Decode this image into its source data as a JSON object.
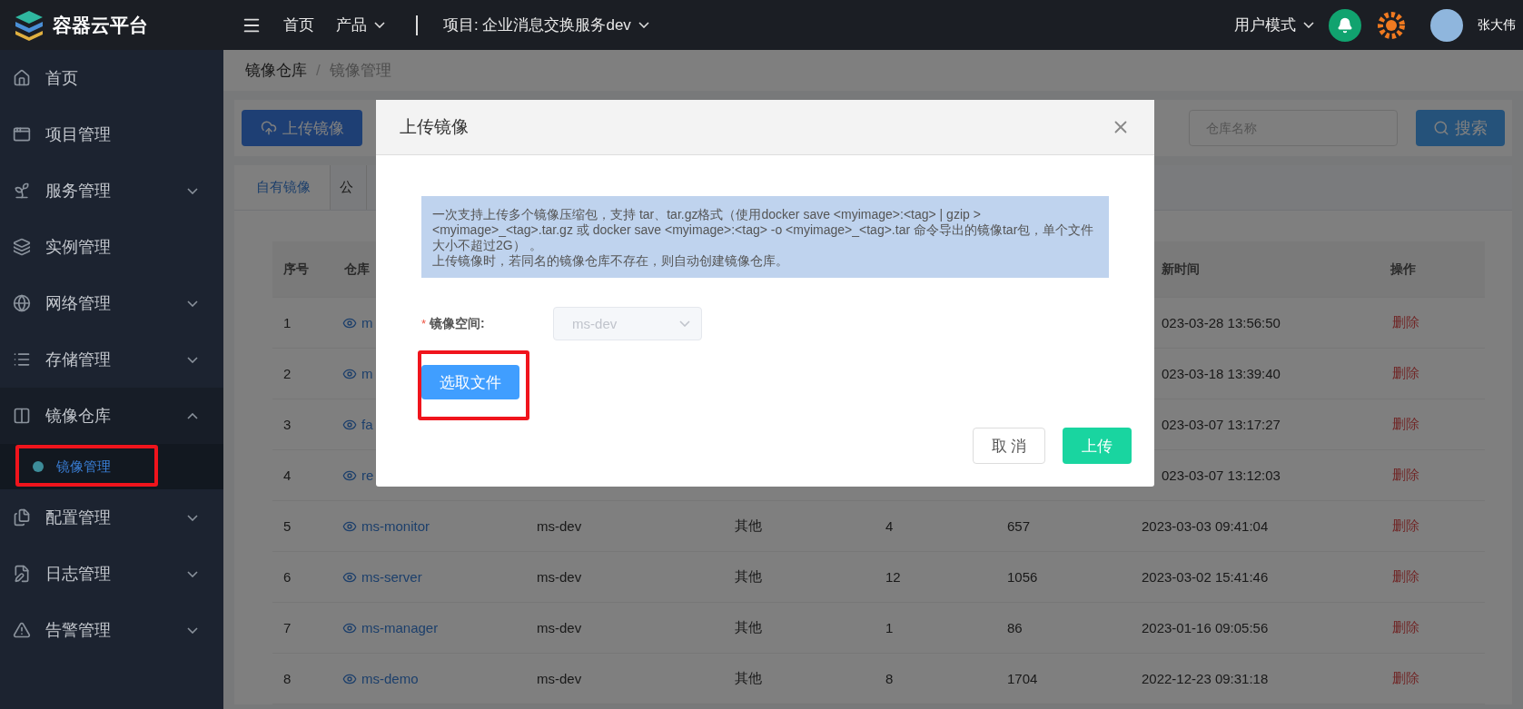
{
  "header": {
    "title": "容器云平台",
    "nav": [
      {
        "label": "首页",
        "dropdown": false
      },
      {
        "label": "产品",
        "dropdown": true
      }
    ],
    "project": "项目: 企业消息交换服务dev",
    "mode": "用户模式",
    "user": "张大伟"
  },
  "sidebar": {
    "items": [
      {
        "label": "首页"
      },
      {
        "label": "项目管理"
      },
      {
        "label": "服务管理",
        "expanded": false
      },
      {
        "label": "实例管理"
      },
      {
        "label": "网络管理",
        "expanded": false
      },
      {
        "label": "存储管理",
        "expanded": false
      },
      {
        "label": "镜像仓库",
        "expanded": true,
        "children": [
          {
            "label": "镜像管理",
            "selected": true
          }
        ]
      },
      {
        "label": "配置管理",
        "expanded": false
      },
      {
        "label": "日志管理",
        "expanded": false
      },
      {
        "label": "告警管理",
        "expanded": false
      }
    ]
  },
  "breadcrumb": {
    "items": [
      "镜像仓库",
      "镜像管理"
    ],
    "separator": "/"
  },
  "toolbar": {
    "upload_button": "上传镜像",
    "search": {
      "placeholder": "仓库名称"
    },
    "search_button": "搜索"
  },
  "tabs": [
    {
      "label": "自有镜像",
      "selected": true
    },
    {
      "label": "公",
      "selected": false
    }
  ],
  "table": {
    "columns": [
      "序号",
      "仓库",
      "新时间",
      "操作"
    ],
    "rows": [
      {
        "no": "1",
        "name": "m",
        "time": "023-03-28 13:56:50",
        "action": "删除"
      },
      {
        "no": "2",
        "name": "m",
        "time": "023-03-18 13:39:40",
        "action": "删除"
      },
      {
        "no": "3",
        "name": "fa",
        "time": "023-03-07 13:17:27",
        "action": "删除"
      },
      {
        "no": "4",
        "name": "re",
        "time": "023-03-07 13:12:03",
        "action": "删除"
      },
      {
        "no": "5",
        "name": "ms-monitor",
        "space": "ms-dev",
        "type": "其他",
        "count": "4",
        "size": "657",
        "time": "2023-03-03 09:41:04",
        "action": "删除"
      },
      {
        "no": "6",
        "name": "ms-server",
        "space": "ms-dev",
        "type": "其他",
        "count": "12",
        "size": "1056",
        "time": "2023-03-02 15:41:46",
        "action": "删除"
      },
      {
        "no": "7",
        "name": "ms-manager",
        "space": "ms-dev",
        "type": "其他",
        "count": "1",
        "size": "86",
        "time": "2023-01-16 09:05:56",
        "action": "删除"
      },
      {
        "no": "8",
        "name": "ms-demo",
        "space": "ms-dev",
        "type": "其他",
        "count": "8",
        "size": "1704",
        "time": "2022-12-23 09:31:18",
        "action": "删除"
      }
    ]
  },
  "dialog": {
    "title": "上传镜像",
    "notice": [
      "一次支持上传多个镜像压缩包，支持 tar、tar.gz格式（使用docker save <myimage>:<tag> | gzip > <myimage>_<tag>.tar.gz 或 docker save <myimage>:<tag> -o <myimage>_<tag>.tar 命令导出的镜像tar包，单个文件大小不超过2G）  。",
      "上传镜像时，若同名的镜像仓库不存在，则自动创建镜像仓库。"
    ],
    "field": {
      "label": "镜像空间:",
      "required_mark": "*",
      "value": "ms-dev",
      "disabled": true
    },
    "choose_button": "选取文件",
    "cancel_button": "取 消",
    "submit_button": "上传"
  }
}
